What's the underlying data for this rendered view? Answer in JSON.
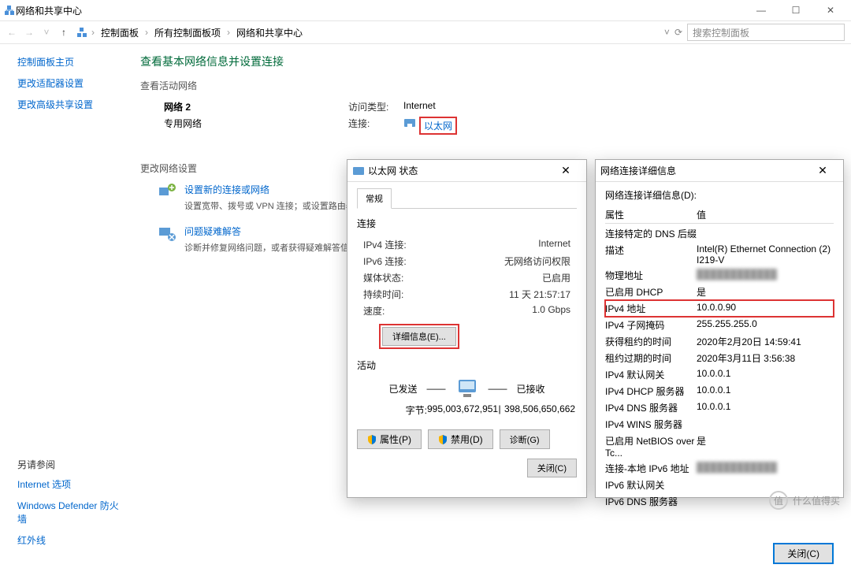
{
  "window": {
    "title": "网络和共享中心",
    "min": "—",
    "max": "☐",
    "close": "✕",
    "breadcrumb": [
      "控制面板",
      "所有控制面板项",
      "网络和共享中心"
    ],
    "search_placeholder": "搜索控制面板"
  },
  "sidebar": {
    "items": [
      "控制面板主页",
      "更改适配器设置",
      "更改高级共享设置"
    ],
    "see_also_head": "另请参阅",
    "see_also": [
      "Internet 选项",
      "Windows Defender 防火墙",
      "红外线"
    ]
  },
  "main": {
    "heading": "查看基本网络信息并设置连接",
    "active_head": "查看活动网络",
    "net_name": "网络 2",
    "net_type": "专用网络",
    "access_label": "访问类型:",
    "access_value": "Internet",
    "conn_label": "连接:",
    "conn_link": "以太网",
    "change_head": "更改网络设置",
    "opt1_title": "设置新的连接或网络",
    "opt1_desc": "设置宽带、拨号或 VPN 连接；或设置路由器或接入点。",
    "opt2_title": "问题疑难解答",
    "opt2_desc": "诊断并修复网络问题，或者获得疑难解答信息。"
  },
  "status_dlg": {
    "title": "以太网 状态",
    "tab": "常规",
    "conn_head": "连接",
    "rows": [
      [
        "IPv4 连接:",
        "Internet"
      ],
      [
        "IPv6 连接:",
        "无网络访问权限"
      ],
      [
        "媒体状态:",
        "已启用"
      ],
      [
        "持续时间:",
        "11 天 21:57:17"
      ],
      [
        "速度:",
        "1.0 Gbps"
      ]
    ],
    "details_btn": "详细信息(E)...",
    "activity_head": "活动",
    "sent": "已发送",
    "recv": "已接收",
    "bytes_label": "字节:",
    "bytes_sent": "995,003,672,951",
    "bytes_recv": "398,506,650,662",
    "divider": "|",
    "btn_props": "属性(P)",
    "btn_disable": "禁用(D)",
    "btn_diag": "诊断(G)",
    "btn_close": "关闭(C)"
  },
  "details_dlg": {
    "title": "网络连接详细信息",
    "label": "网络连接详细信息(D):",
    "head_k": "属性",
    "head_v": "值",
    "rows": [
      [
        "连接特定的 DNS 后缀",
        ""
      ],
      [
        "描述",
        "Intel(R) Ethernet Connection (2) I219-V"
      ],
      [
        "物理地址",
        "████████████"
      ],
      [
        "已启用 DHCP",
        "是"
      ],
      [
        "IPv4 地址",
        "10.0.0.90"
      ],
      [
        "IPv4 子网掩码",
        "255.255.255.0"
      ],
      [
        "获得租约的时间",
        "2020年2月20日 14:59:41"
      ],
      [
        "租约过期的时间",
        "2020年3月11日 3:56:38"
      ],
      [
        "IPv4 默认网关",
        "10.0.0.1"
      ],
      [
        "IPv4 DHCP 服务器",
        "10.0.0.1"
      ],
      [
        "IPv4 DNS 服务器",
        "10.0.0.1"
      ],
      [
        "IPv4 WINS 服务器",
        ""
      ],
      [
        "已启用 NetBIOS over Tc...",
        "是"
      ],
      [
        "连接-本地 IPv6 地址",
        "████████████"
      ],
      [
        "IPv6 默认网关",
        ""
      ],
      [
        "IPv6 DNS 服务器",
        ""
      ]
    ],
    "btn_close": "关闭(C)"
  },
  "watermark": {
    "text": "什么值得买"
  }
}
